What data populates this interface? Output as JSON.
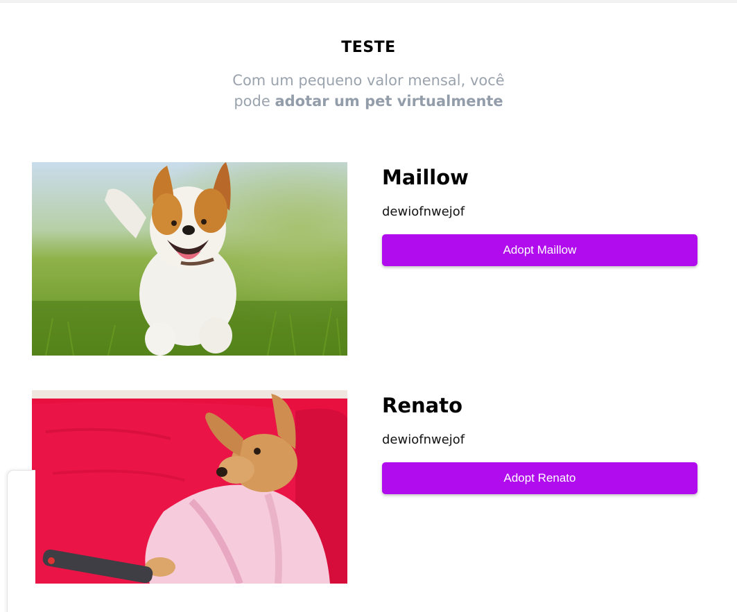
{
  "header": {
    "title": "TESTE",
    "subtitle_prefix": "Com um pequeno valor mensal, você pode ",
    "subtitle_emphasis": "adotar um pet virtualmente"
  },
  "pets": [
    {
      "name": "Maillow",
      "description": "dewiofnwejof",
      "button_label": "Adopt Maillow",
      "image_alt": "Jack Russell terrier running on grass"
    },
    {
      "name": "Renato",
      "description": "dewiofnwejof",
      "button_label": "Adopt Renato",
      "image_alt": "Chihuahua in pink bathrobe on red sofa with remote"
    }
  ],
  "colors": {
    "accent": "#b10ced",
    "subtitle": "#9aa3ad"
  }
}
